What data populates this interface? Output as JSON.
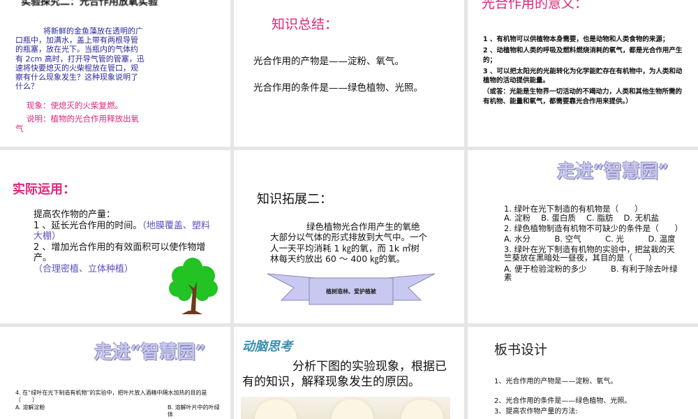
{
  "slides": [
    {
      "title": "实验探究二：光合作用放氧实验",
      "body": "将新鲜的金鱼藻放在透明的广口瓶中，加满水，盖上带有两根导管的瓶塞，放在光下。当瓶内的气体约有 2cm 高时，打开导气管的管塞，迅速将快要熄灭的火柴棍放在管口，观察有什么现象发生？这种现象说明了什么？",
      "phenomenon": "现象：使熄灭的火柴复燃。",
      "explanation": "说明：植物的光合作用释放出氧气"
    },
    {
      "title": "知识总结：",
      "line1": "光合作用的产物是——淀粉、氧气。",
      "line2": "光合作用的条件是——绿色植物、光照。"
    },
    {
      "title": "光合作用的意义：",
      "items": [
        "1 、有机物可以供植物本身需要，也是动物和人类食物的来源；",
        "2 、动植物和人类的呼吸及燃料燃烧消耗的氧气，都是光合作用产生的；",
        "3 、可以把太阳光的光能转化为化学能贮存在有机物中，为人类和动植物的活动提供能量。",
        "（或答：光能是生物界一切活动的不竭动力，人类和其他生物所需的有机物、能量和氧气，都需要靠光合作用来提供。）"
      ]
    },
    {
      "title": "实际运用：",
      "intro": "提高农作物的产量：",
      "item1": "1 、延长光合作用的时间。",
      "item1_note": "（地膜覆盖、塑料大棚）",
      "item2": "2 、增加光合作用的有效面积可以使作物增产。",
      "item2_note": "（合理密植、立体种植）"
    },
    {
      "title": "知识拓展二：",
      "body": "绿色植物光合作用产生的氧绝大部分以气体的形式排放到大气中。一个人一天平均消耗 1 ㎏的氧，而 1k ㎡树林每天约放出 60 ～ 400 ㎏的氧。",
      "banner": "植树造林、爱护植被"
    },
    {
      "title": "走进“智慧园”",
      "q1": "1. 绿叶在光下制造的有机物是（　　）",
      "q1_opts": "A. 淀粉　 B. 蛋白质　 C. 脂肪　 D. 无机盐",
      "q2": "2. 绿色植物制造有机物不可缺少的条件是（　　）",
      "q2_opts": "A. 水分　　　B. 空气　　　C. 光　　　D. 温度",
      "q3": "3. 绿叶在光下制造有机物的实验中，把盆栽的天竺葵放在黑暗处一昼夜，其目的是（　　）",
      "q3_opts": "A. 便于检验淀粉的多少　　　B. 有利于除去叶绿素"
    },
    {
      "title": "走进“智慧园”",
      "q4": "4. 在“绿叶在光下制造有机物”的实验中，把叶片放入酒精中隔水加热的目的是（　　）",
      "optA": "A. 溶解淀粉",
      "optB": "B. 溶解叶片中的叶绿体"
    },
    {
      "title": "动脑思考",
      "body": "分析下图的实验现象，根据已有的知识，解释现象发生的原因。"
    },
    {
      "title": "板书设计",
      "line1": "1、光合作用的产物是——淀粉、氧气。",
      "line2": "2、光合作用的条件是——绿色植物、光照。",
      "line3": "3、提高农作物产量的方法:"
    }
  ]
}
